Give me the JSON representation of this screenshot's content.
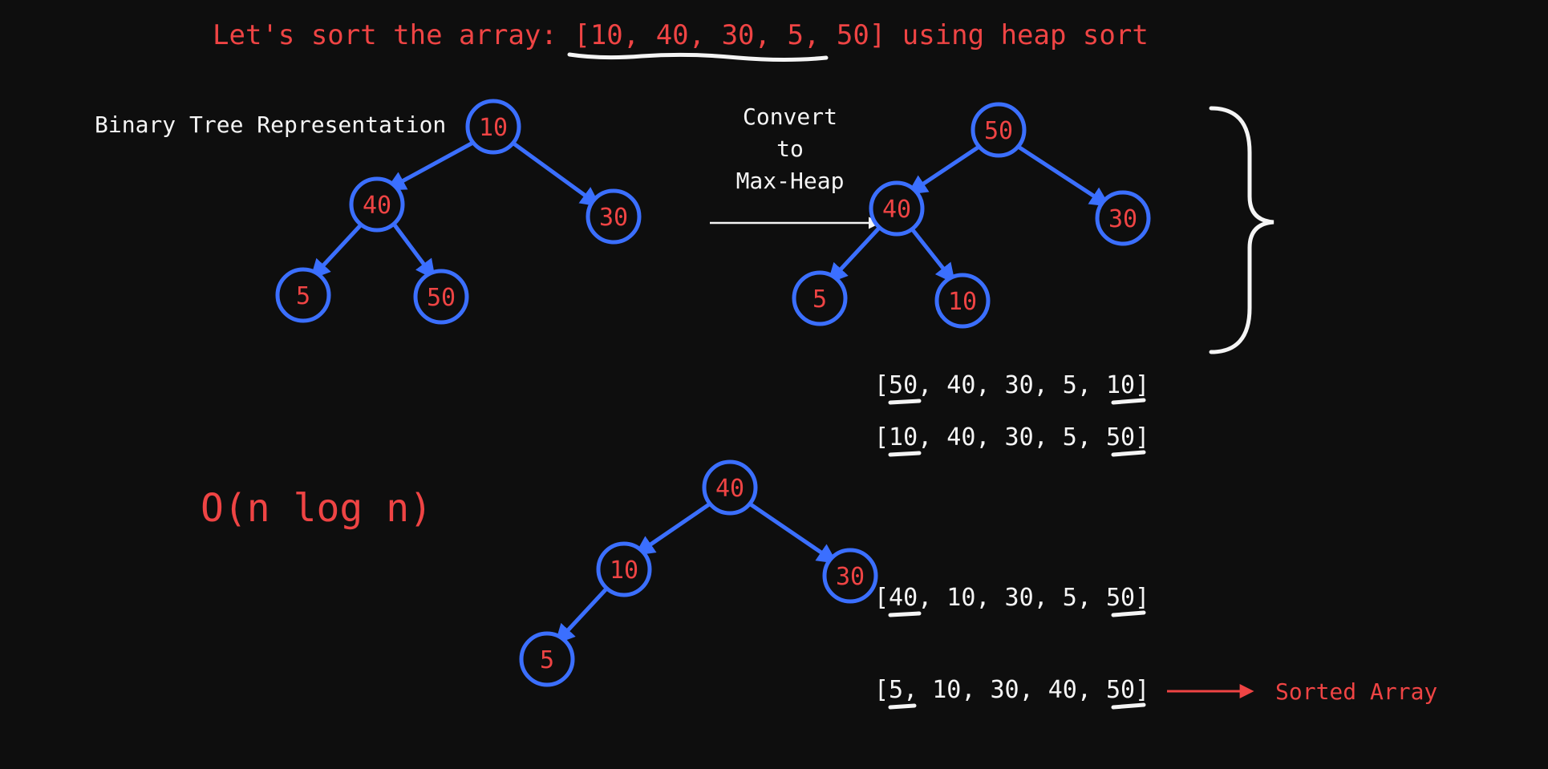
{
  "title": {
    "prefix": "Let's sort the array: ",
    "array": "[10, 40, 30, 5, 50]",
    "suffix": " using heap sort"
  },
  "labels": {
    "binary_tree": "Binary Tree Representation",
    "convert1": "Convert",
    "convert2": "to",
    "convert3": "Max-Heap",
    "sorted": "Sorted Array"
  },
  "complexity": "O(n log n)",
  "trees": {
    "initial": {
      "root": "10",
      "l": "40",
      "r": "30",
      "ll": "5",
      "lr": "50"
    },
    "max_heap": {
      "root": "50",
      "l": "40",
      "r": "30",
      "ll": "5",
      "lr": "10"
    },
    "step": {
      "root": "40",
      "l": "10",
      "r": "30",
      "ll": "5"
    }
  },
  "arrays": {
    "a1": "[50, 40, 30, 5, 10]",
    "a2": "[10, 40, 30, 5, 50]",
    "a3": "[40, 10, 30, 5, 50]",
    "a4": "[5, 10, 30, 40, 50]"
  },
  "chart_data": {
    "type": "table",
    "description": "Heap sort walkthrough on [10,40,30,5,50]",
    "input_array": [
      10,
      40,
      30,
      5,
      50
    ],
    "binary_tree_level_order": [
      10,
      40,
      30,
      5,
      50
    ],
    "max_heap_level_order": [
      50,
      40,
      30,
      5,
      10
    ],
    "after_swap_root_last": [
      10,
      40,
      30,
      5,
      50
    ],
    "reheapified_subtree": [
      40,
      10,
      30,
      5
    ],
    "array_after_reheapify": [
      40,
      10,
      30,
      5,
      50
    ],
    "sorted_array": [
      5,
      10,
      30,
      40,
      50
    ],
    "time_complexity": "O(n log n)"
  }
}
